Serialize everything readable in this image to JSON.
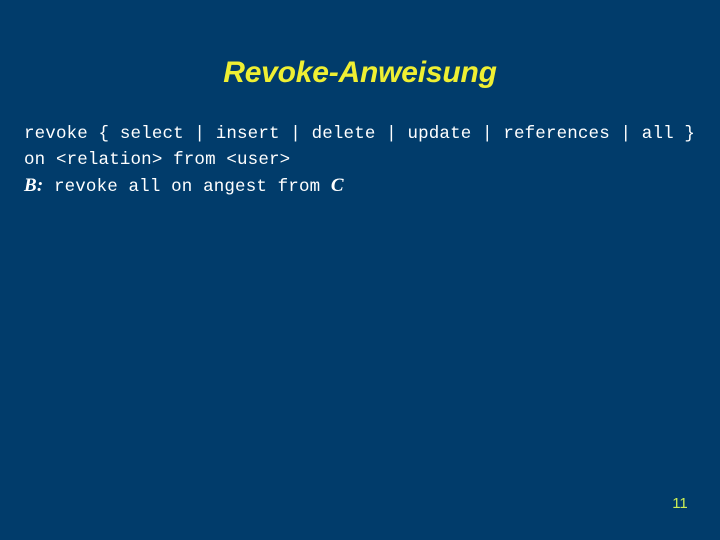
{
  "slide": {
    "title": "Revoke-Anweisung",
    "page_number": "11",
    "background_color": "#013c6b",
    "title_color": "#efef33",
    "body_text_color": "#ffffff",
    "page_number_color": "#ccee55"
  },
  "body": {
    "lines": [
      {
        "id": "syntax-line-1",
        "text": "revoke { select | insert | delete | update | references | all }"
      },
      {
        "id": "syntax-line-2",
        "text": "on <relation> from <user>"
      }
    ],
    "example": {
      "id": "example-line",
      "label": "B:",
      "statement": " revoke all on angest from ",
      "grantee": "C",
      "full_text": "B: revoke all on angest from C"
    }
  }
}
